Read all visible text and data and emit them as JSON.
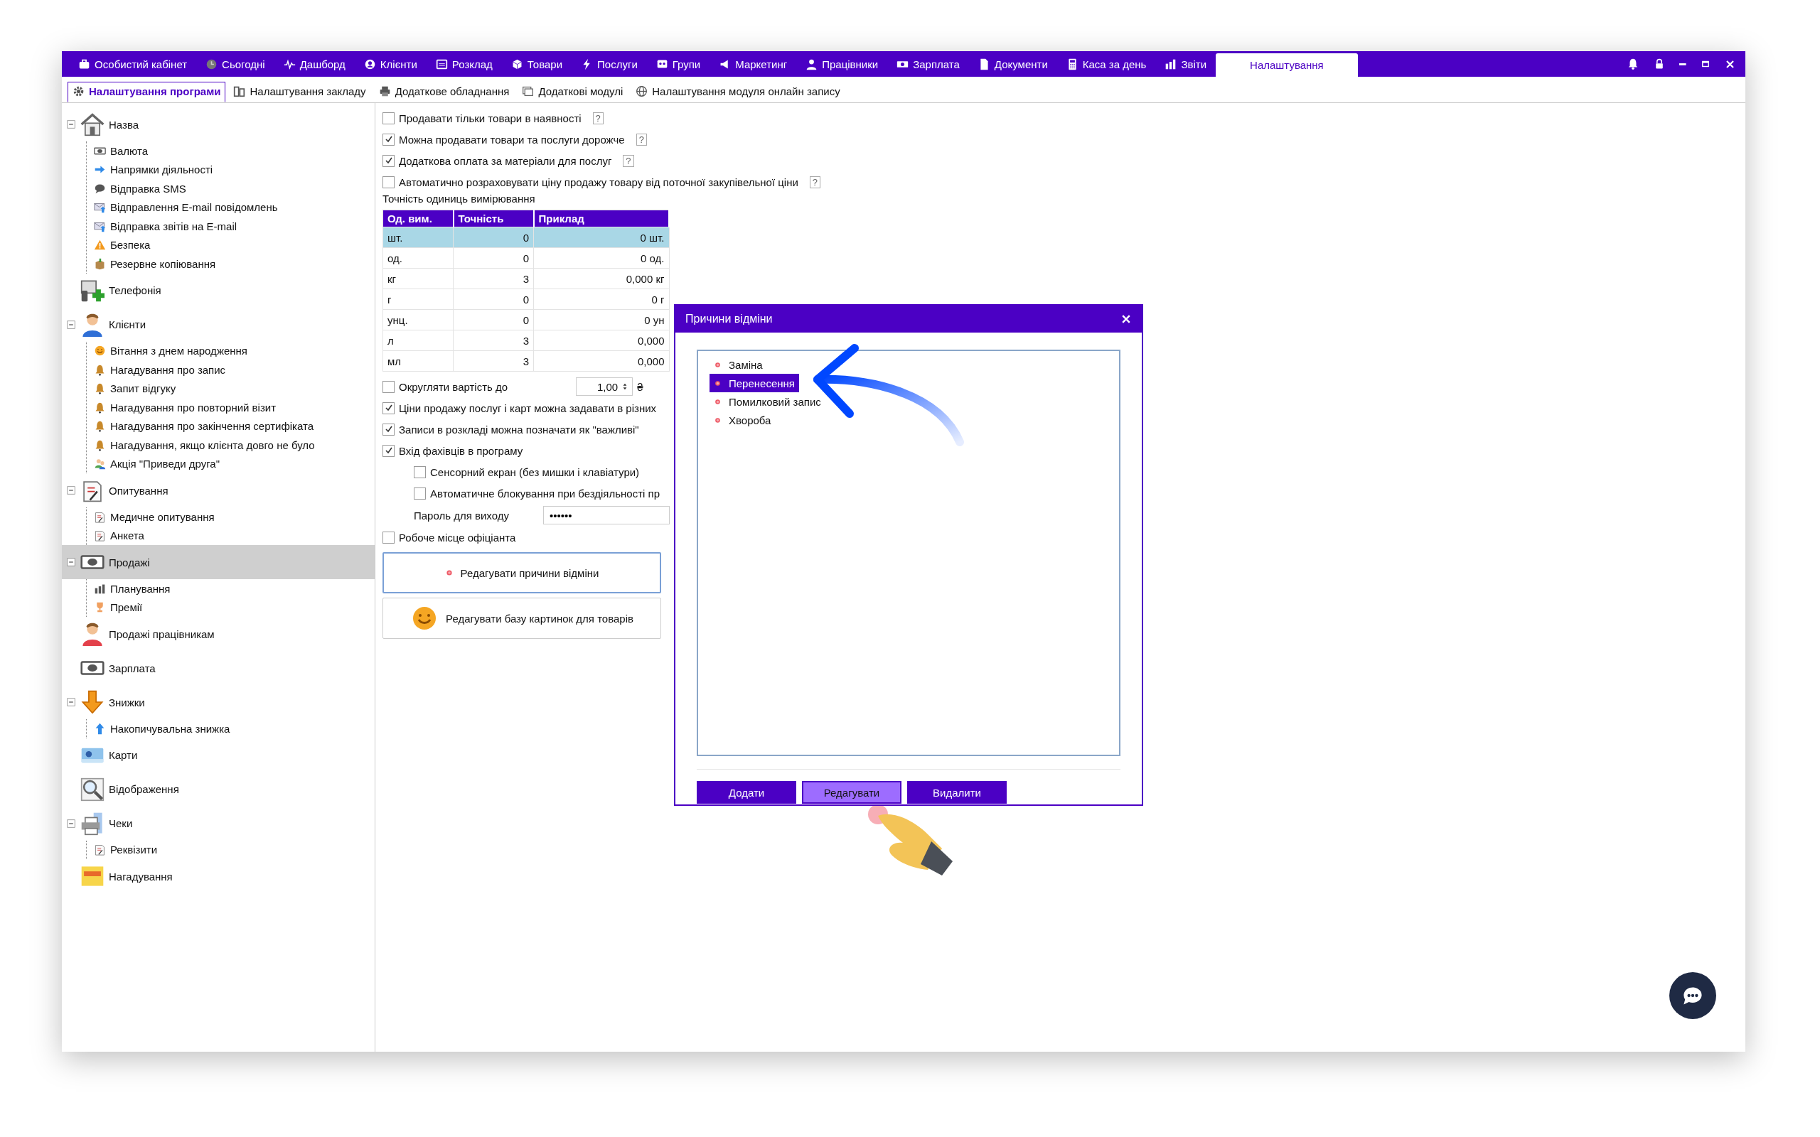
{
  "top_menu": [
    {
      "label": "Особистий кабінет",
      "selected": false
    },
    {
      "label": "Сьогодні",
      "selected": false
    },
    {
      "label": "Дашборд",
      "selected": false
    },
    {
      "label": "Клієнти",
      "selected": false
    },
    {
      "label": "Розклад",
      "selected": false
    },
    {
      "label": "Товари",
      "selected": false
    },
    {
      "label": "Послуги",
      "selected": false
    },
    {
      "label": "Групи",
      "selected": false
    },
    {
      "label": "Маркетинг",
      "selected": false
    },
    {
      "label": "Працівники",
      "selected": false
    },
    {
      "label": "Зарплата",
      "selected": false
    },
    {
      "label": "Документи",
      "selected": false
    },
    {
      "label": "Каса за день",
      "selected": false
    },
    {
      "label": "Звіти",
      "selected": false
    },
    {
      "label": "Налаштування",
      "selected": true
    }
  ],
  "sub_tabs": [
    {
      "label": "Налаштування програми",
      "selected": true
    },
    {
      "label": "Налаштування закладу",
      "selected": false
    },
    {
      "label": "Додаткове обладнання",
      "selected": false
    },
    {
      "label": "Додаткові модулі",
      "selected": false
    },
    {
      "label": "Налаштування модуля онлайн запису",
      "selected": false
    }
  ],
  "tree": [
    {
      "label": "Назва",
      "selected": false,
      "expanded": true,
      "children": [
        {
          "label": "Валюта"
        },
        {
          "label": "Напрямки діяльності"
        },
        {
          "label": "Відправка SMS"
        },
        {
          "label": "Відправлення E-mail повідомлень"
        },
        {
          "label": "Відправка звітів на E-mail"
        },
        {
          "label": "Безпека"
        },
        {
          "label": "Резервне копіювання"
        }
      ]
    },
    {
      "label": "Телефонія",
      "selected": false
    },
    {
      "label": "Клієнти",
      "selected": false,
      "expanded": true,
      "children": [
        {
          "label": "Вітання з днем народження"
        },
        {
          "label": "Нагадування про запис"
        },
        {
          "label": "Запит відгуку"
        },
        {
          "label": "Нагадування про повторний візит"
        },
        {
          "label": "Нагадування про закінчення сертифіката"
        },
        {
          "label": "Нагадування, якщо клієнта довго не було"
        },
        {
          "label": "Акція \"Приведи друга\""
        }
      ]
    },
    {
      "label": "Опитування",
      "selected": false,
      "expanded": true,
      "children": [
        {
          "label": "Медичне опитування"
        },
        {
          "label": "Анкета"
        }
      ]
    },
    {
      "label": "Продажі",
      "selected": true,
      "expanded": true,
      "children": [
        {
          "label": "Планування"
        },
        {
          "label": "Премії"
        }
      ]
    },
    {
      "label": "Продажі працівникам",
      "selected": false
    },
    {
      "label": "Зарплата",
      "selected": false
    },
    {
      "label": "Знижки",
      "selected": false,
      "expanded": true,
      "children": [
        {
          "label": "Накопичувальна знижка"
        }
      ]
    },
    {
      "label": "Карти",
      "selected": false
    },
    {
      "label": "Відображення",
      "selected": false
    },
    {
      "label": "Чеки",
      "selected": false,
      "expanded": true,
      "children": [
        {
          "label": "Реквізити"
        }
      ]
    },
    {
      "label": "Нагадування",
      "selected": false
    }
  ],
  "options": [
    {
      "label": "Продавати тільки товари в наявності",
      "checked": false,
      "help": "?"
    },
    {
      "label": "Можна продавати товари та послуги дорожче",
      "checked": true,
      "help": "?"
    },
    {
      "label": "Додаткова оплата за матеріали для послуг",
      "checked": true,
      "help": "?"
    },
    {
      "label": "Автоматично розраховувати ціну продажу товару від поточної закупівельної ціни",
      "checked": false,
      "help": "?"
    }
  ],
  "precision": {
    "title": "Точність одиниць вимірювання",
    "columns": [
      "Од. вим.",
      "Точність",
      "Приклад"
    ],
    "rows": [
      {
        "cells": [
          "шт.",
          "0",
          "0 шт."
        ],
        "selected": true
      },
      {
        "cells": [
          "од.",
          "0",
          "0 од."
        ],
        "selected": false
      },
      {
        "cells": [
          "кг",
          "3",
          "0,000 кг"
        ],
        "selected": false
      },
      {
        "cells": [
          "г",
          "0",
          "0 г"
        ],
        "selected": false
      },
      {
        "cells": [
          "унц.",
          "0",
          "0 ун"
        ],
        "selected": false
      },
      {
        "cells": [
          "л",
          "3",
          "0,000"
        ],
        "selected": false
      },
      {
        "cells": [
          "мл",
          "3",
          "0,000"
        ],
        "selected": false
      }
    ]
  },
  "rounding": {
    "label": "Округляти вартість до",
    "checked": false,
    "value": "1,00",
    "currency": "₴"
  },
  "options2": [
    {
      "label": "Ціни продажу послуг і карт можна задавати в різних",
      "checked": true
    },
    {
      "label": "Записи в розкладі можна позначати як \"важливі\"",
      "checked": true
    },
    {
      "label": "Вхід фахівців в програму",
      "checked": true,
      "children": [
        {
          "label": "Сенсорний екран (без мишки і клавіатури)",
          "checked": false
        },
        {
          "label": "Автоматичне блокування при бездіяльності пр",
          "checked": false
        }
      ],
      "password": {
        "label": "Пароль для виходу",
        "value": "••••••"
      }
    },
    {
      "label": "Робоче місце офіціанта",
      "checked": false
    }
  ],
  "action_buttons": [
    {
      "label": "Редагувати причини відміни",
      "focused": true
    },
    {
      "label": "Редагувати базу картинок для товарів",
      "focused": false
    }
  ],
  "dialog": {
    "title": "Причини відміни",
    "items": [
      {
        "label": "Заміна",
        "selected": false
      },
      {
        "label": "Перенесення",
        "selected": true
      },
      {
        "label": "Помилковий запис",
        "selected": false
      },
      {
        "label": "Хвороба",
        "selected": false
      }
    ],
    "buttons": [
      {
        "label": "Додати",
        "hovered": false
      },
      {
        "label": "Редагувати",
        "hovered": true
      },
      {
        "label": "Видалити",
        "hovered": false
      }
    ]
  }
}
